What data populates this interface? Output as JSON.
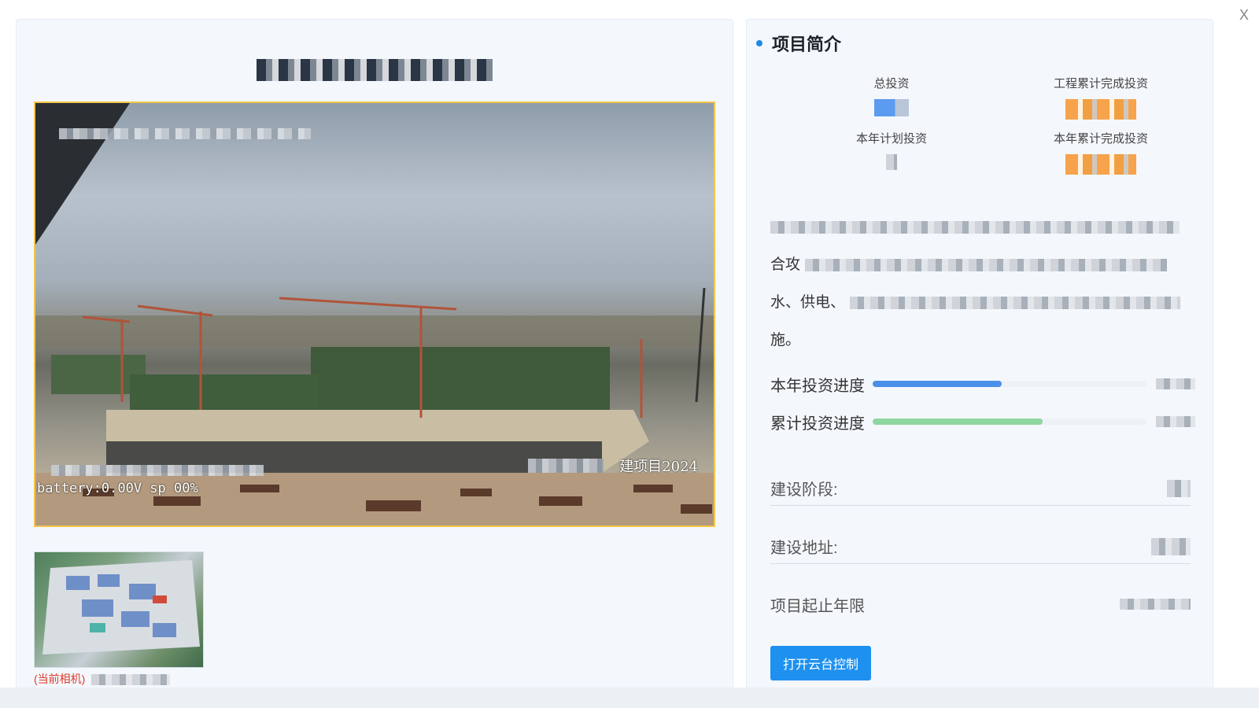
{
  "close_label": "X",
  "camera": {
    "osd_battery": "battery:0.00V  sp  00%",
    "osd_watermark": "建项目2024",
    "thumbnail_caption": "(当前相机)"
  },
  "project": {
    "section_title": "项目简介",
    "stats": [
      {
        "label": "总投资"
      },
      {
        "label": "工程累计完成投资"
      },
      {
        "label": "本年计划投资"
      },
      {
        "label": "本年累计完成投资"
      }
    ],
    "description": {
      "line2_prefix": "合攻",
      "line3_prefix": "水、供电、",
      "line4_text": "施。"
    },
    "progress": [
      {
        "label": "本年投资进度",
        "percent": 47,
        "color": "#4a90e8"
      },
      {
        "label": "累计投资进度",
        "percent": 62,
        "color": "#8fd6a0"
      }
    ],
    "fields": {
      "stage_label": "建设阶段:",
      "address_label": "建设地址:",
      "period_label": "项目起止年限"
    },
    "ptz_button": "打开云台控制"
  }
}
